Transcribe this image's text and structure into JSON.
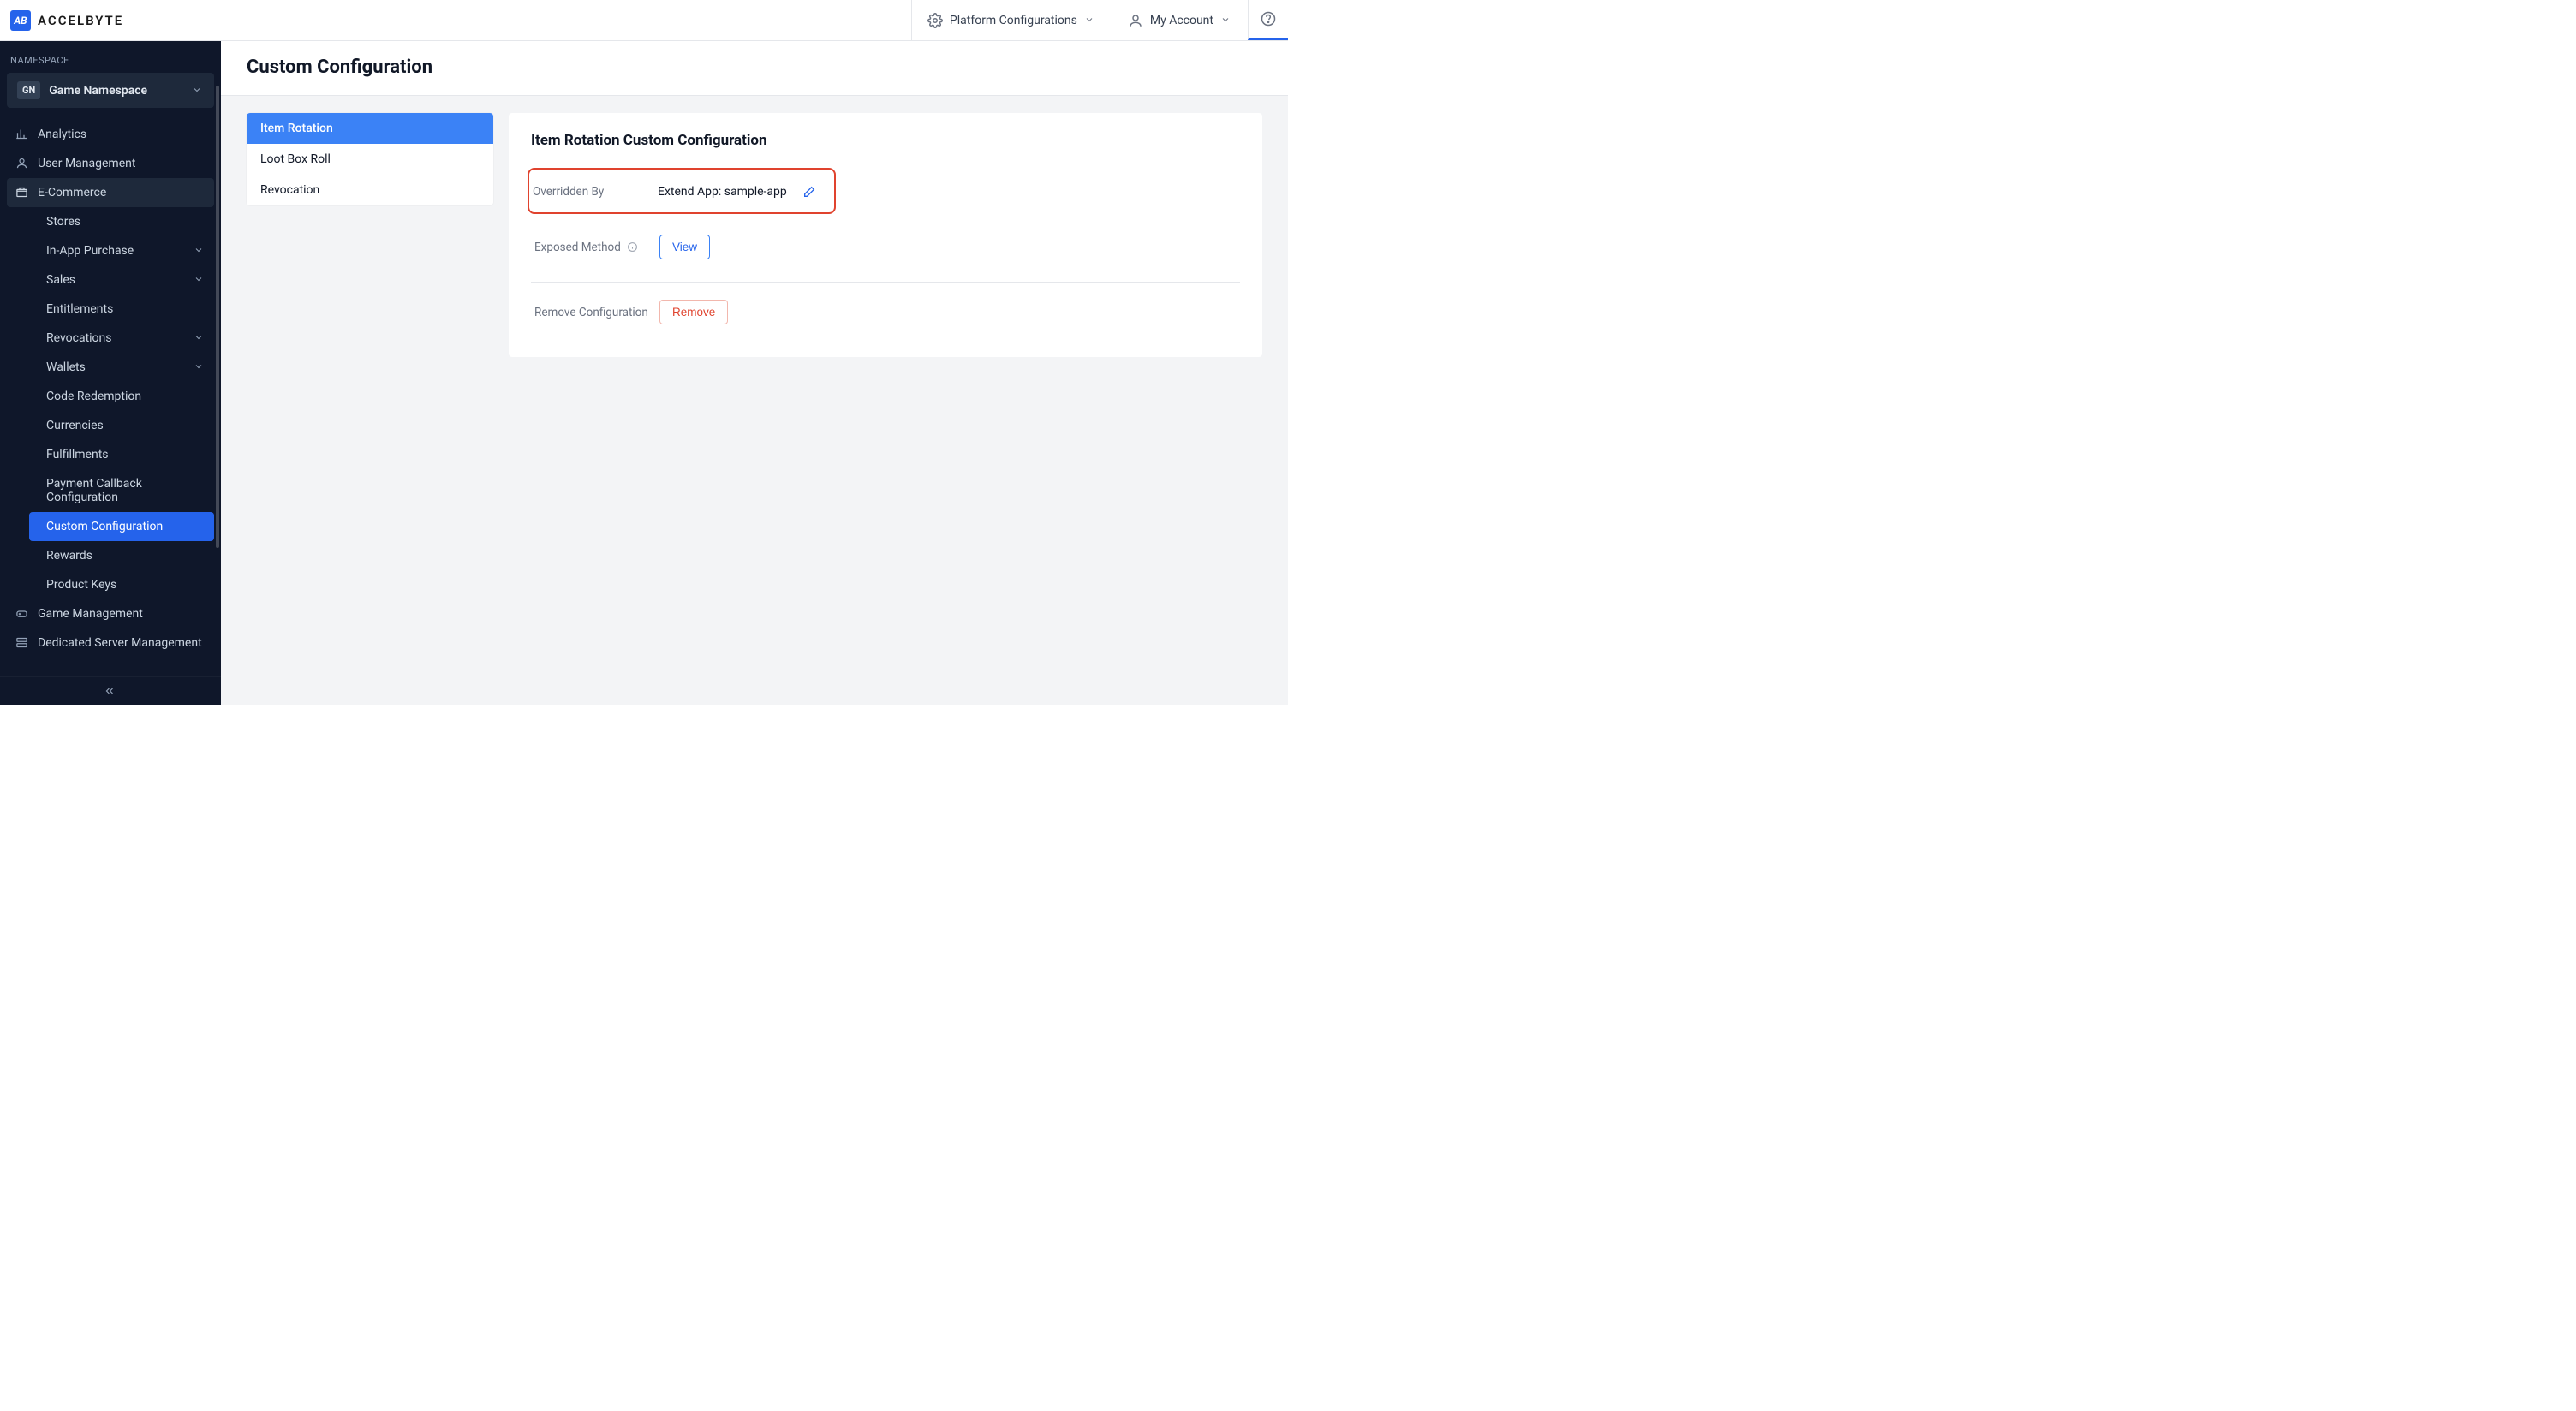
{
  "brand": {
    "text": "ACCELBYTE",
    "logo_letters": "AB"
  },
  "topbar": {
    "platform_config_label": "Platform Configurations",
    "account_label": "My Account"
  },
  "sidebar": {
    "section_label": "NAMESPACE",
    "namespace": {
      "badge": "GN",
      "name": "Game Namespace"
    },
    "items": [
      {
        "label": "Analytics"
      },
      {
        "label": "User Management"
      },
      {
        "label": "E-Commerce"
      },
      {
        "label": "Game Management"
      },
      {
        "label": "Dedicated Server Management"
      }
    ],
    "ecommerce_children": [
      {
        "label": "Stores",
        "expandable": false
      },
      {
        "label": "In-App Purchase",
        "expandable": true
      },
      {
        "label": "Sales",
        "expandable": true
      },
      {
        "label": "Entitlements",
        "expandable": false
      },
      {
        "label": "Revocations",
        "expandable": true
      },
      {
        "label": "Wallets",
        "expandable": true
      },
      {
        "label": "Code Redemption",
        "expandable": false
      },
      {
        "label": "Currencies",
        "expandable": false
      },
      {
        "label": "Fulfillments",
        "expandable": false
      },
      {
        "label": "Payment Callback Configuration",
        "expandable": false
      },
      {
        "label": "Custom Configuration",
        "expandable": false,
        "active": true
      },
      {
        "label": "Rewards",
        "expandable": false
      },
      {
        "label": "Product Keys",
        "expandable": false
      }
    ]
  },
  "page": {
    "title": "Custom Configuration"
  },
  "vtabs": [
    {
      "label": "Item Rotation",
      "active": true
    },
    {
      "label": "Loot Box Roll"
    },
    {
      "label": "Revocation"
    }
  ],
  "card": {
    "title": "Item Rotation Custom Configuration",
    "overridden_by_label": "Overridden By",
    "overridden_by_value": "Extend App: sample-app",
    "exposed_method_label": "Exposed Method",
    "view_button": "View",
    "remove_label": "Remove Configuration",
    "remove_button": "Remove"
  }
}
